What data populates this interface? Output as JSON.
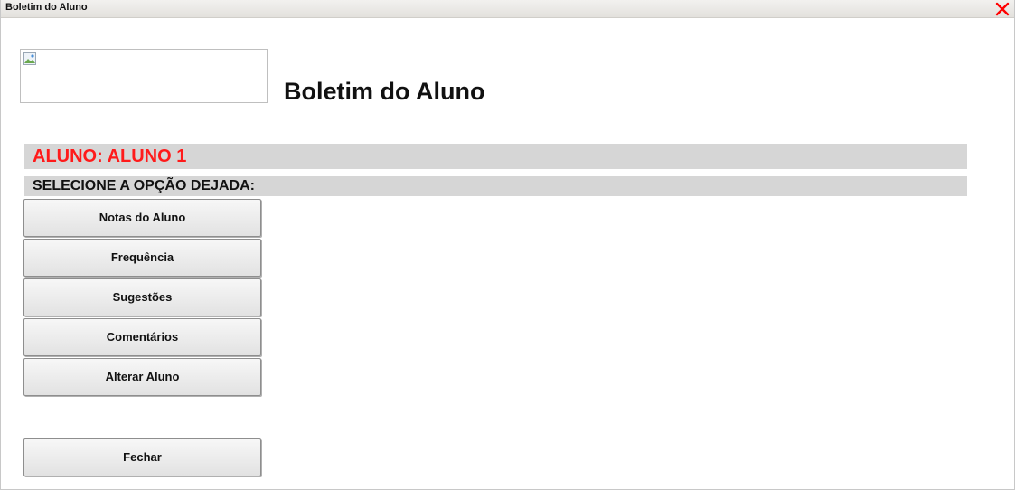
{
  "window": {
    "title": "Boletim do Aluno",
    "close_icon": "close-x-icon",
    "close_color": "#ff0000"
  },
  "header": {
    "logo_icon": "broken-image-icon",
    "title": "Boletim do Aluno"
  },
  "student": {
    "label": "ALUNO: ALUNO 1",
    "label_color": "#ff1a1a"
  },
  "prompt": {
    "label": "SELECIONE A OPÇÃO DEJADA:"
  },
  "menu": {
    "items": [
      {
        "label": "Notas do Aluno"
      },
      {
        "label": "Frequência"
      },
      {
        "label": "Sugestões"
      },
      {
        "label": "Comentários"
      },
      {
        "label": "Alterar Aluno"
      }
    ],
    "close_label": "Fechar"
  }
}
